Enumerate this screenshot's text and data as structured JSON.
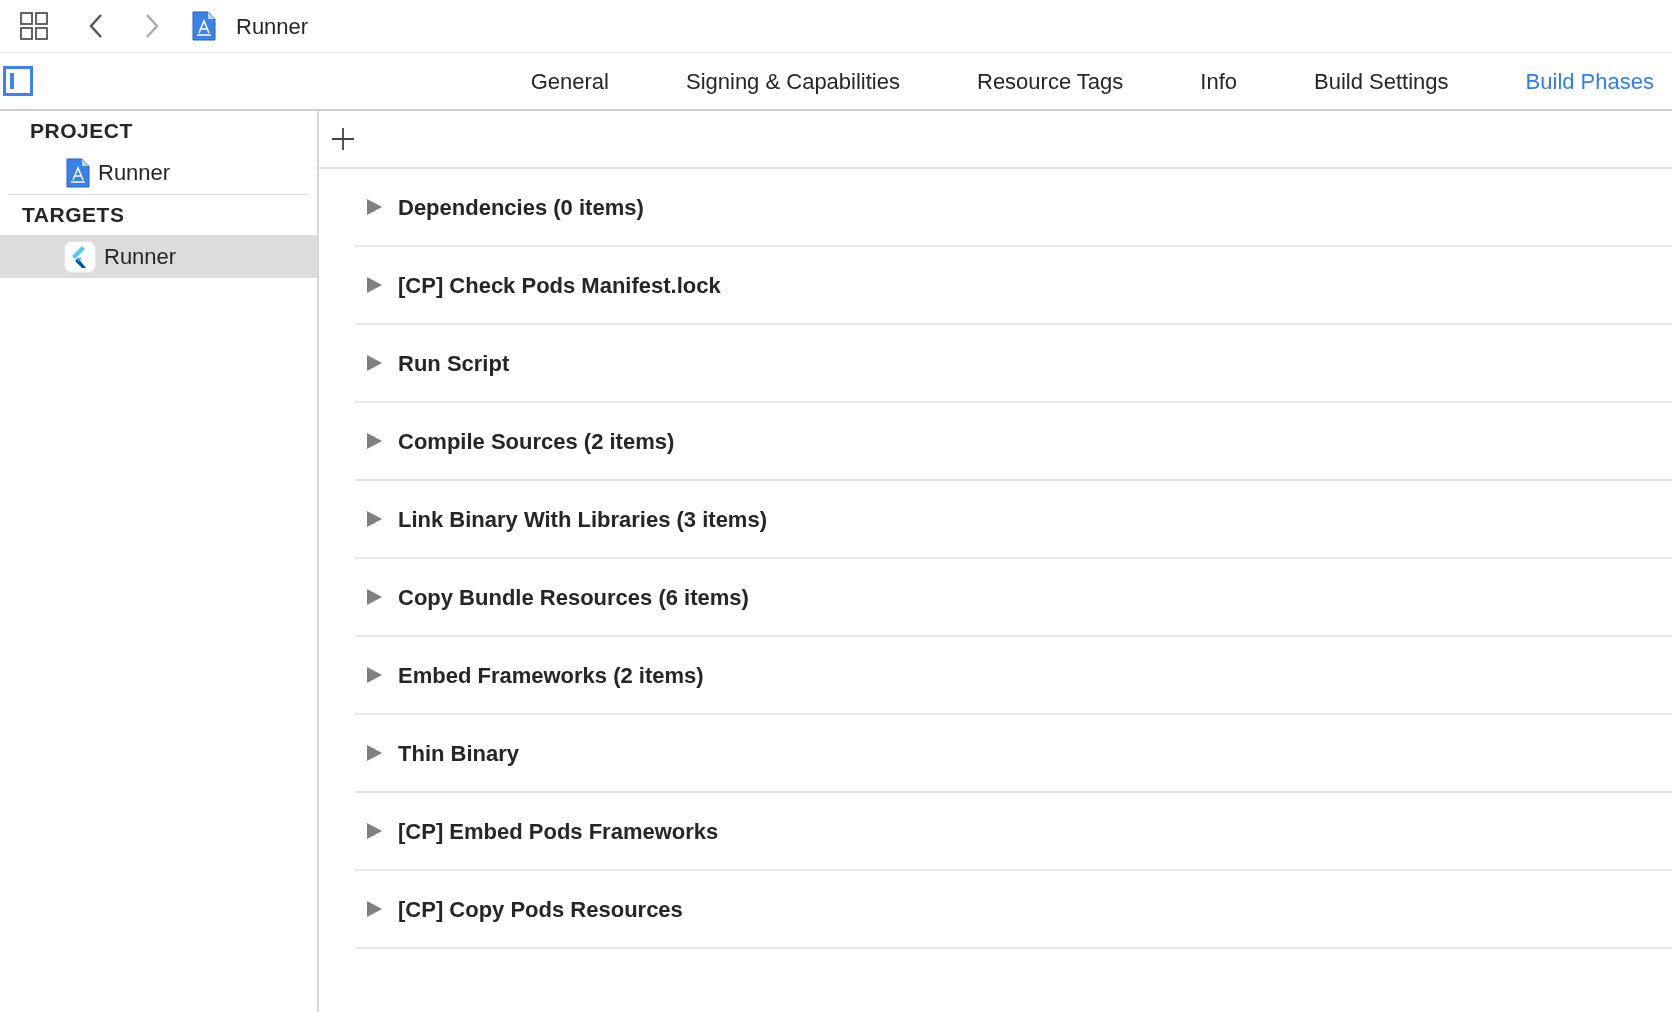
{
  "toolbar": {
    "title": "Runner"
  },
  "tabs": [
    {
      "label": "General",
      "selected": false
    },
    {
      "label": "Signing & Capabilities",
      "selected": false
    },
    {
      "label": "Resource Tags",
      "selected": false
    },
    {
      "label": "Info",
      "selected": false
    },
    {
      "label": "Build Settings",
      "selected": false
    },
    {
      "label": "Build Phases",
      "selected": true
    }
  ],
  "sidebar": {
    "sections": [
      {
        "heading": "PROJECT",
        "items": [
          {
            "label": "Runner",
            "kind": "project",
            "selected": false
          }
        ]
      },
      {
        "heading": "TARGETS",
        "items": [
          {
            "label": "Runner",
            "kind": "target",
            "selected": true
          }
        ]
      }
    ]
  },
  "phases": [
    {
      "title": "Dependencies (0 items)",
      "expanded": false
    },
    {
      "title": "[CP] Check Pods Manifest.lock",
      "expanded": false
    },
    {
      "title": "Run Script",
      "expanded": false
    },
    {
      "title": "Compile Sources (2 items)",
      "expanded": false
    },
    {
      "title": "Link Binary With Libraries (3 items)",
      "expanded": false
    },
    {
      "title": "Copy Bundle Resources (6 items)",
      "expanded": false
    },
    {
      "title": "Embed Frameworks (2 items)",
      "expanded": false
    },
    {
      "title": "Thin Binary",
      "expanded": false
    },
    {
      "title": "[CP] Embed Pods Frameworks",
      "expanded": false
    },
    {
      "title": "[CP] Copy Pods Resources",
      "expanded": false
    }
  ]
}
